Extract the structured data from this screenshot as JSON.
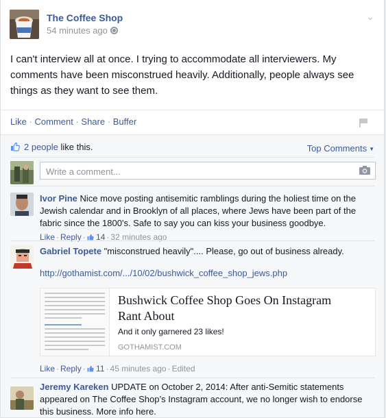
{
  "post": {
    "page_name": "The Coffee Shop",
    "time": "54 minutes ago",
    "text": "I can't interview all at once. I trying to accommodate all interviewers. My comments have been misconstrued heavily. Additionally, people always see things as they want to see them."
  },
  "actions": {
    "like": "Like",
    "comment": "Comment",
    "share": "Share",
    "buffer": "Buffer",
    "sep": "·"
  },
  "likes": {
    "count_label": "2 people",
    "suffix": " like this.",
    "sort_label": "Top Comments"
  },
  "composer": {
    "placeholder": "Write a comment..."
  },
  "comments": [
    {
      "author": "Ivor Pine",
      "text": " Nice move posting antisemitic ramblings during the holiest time on the Jewish calendar and in Brooklyn of all places, where Jews have been part of the fabric since the 1800's. Safe to say you can kiss your business goodbye.",
      "like": "Like",
      "reply": "Reply",
      "likes": "14",
      "time": "32 minutes ago"
    },
    {
      "author": "Gabriel Topete",
      "text": " \"misconstrued heavily\".... Please, go out of business already.",
      "url": "http://gothamist.com/.../10/02/bushwick_coffee_shop_jews.php",
      "like": "Like",
      "reply": "Reply",
      "likes": "11",
      "time": "45 minutes ago",
      "edited": "Edited",
      "link_preview": {
        "title": "Bushwick Coffee Shop Goes On Instagram Rant About",
        "description": "And it only garnered 23 likes!",
        "domain": "GOTHAMIST.COM"
      }
    },
    {
      "author": "Jeremy Kareken",
      "text": " UPDATE on October 2, 2014: After anti-Semitic statements appeared on The Coffee Shop’s Instagram account, we no longer wish to endorse this business. More info here."
    }
  ],
  "colors": {
    "link": "#3b5998",
    "muted": "#90949c",
    "background": "#f6f7f9"
  }
}
